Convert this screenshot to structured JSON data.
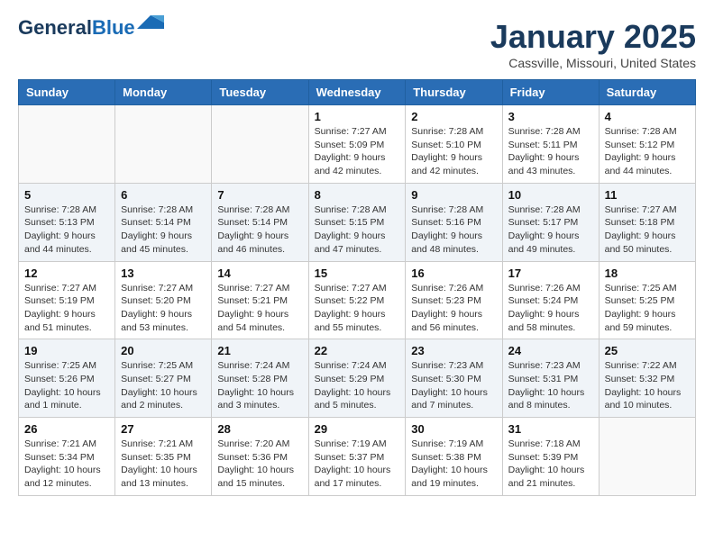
{
  "header": {
    "logo_general": "General",
    "logo_blue": "Blue",
    "month": "January 2025",
    "location": "Cassville, Missouri, United States"
  },
  "weekdays": [
    "Sunday",
    "Monday",
    "Tuesday",
    "Wednesday",
    "Thursday",
    "Friday",
    "Saturday"
  ],
  "weeks": [
    [
      {
        "day": "",
        "info": ""
      },
      {
        "day": "",
        "info": ""
      },
      {
        "day": "",
        "info": ""
      },
      {
        "day": "1",
        "info": "Sunrise: 7:27 AM\nSunset: 5:09 PM\nDaylight: 9 hours and 42 minutes."
      },
      {
        "day": "2",
        "info": "Sunrise: 7:28 AM\nSunset: 5:10 PM\nDaylight: 9 hours and 42 minutes."
      },
      {
        "day": "3",
        "info": "Sunrise: 7:28 AM\nSunset: 5:11 PM\nDaylight: 9 hours and 43 minutes."
      },
      {
        "day": "4",
        "info": "Sunrise: 7:28 AM\nSunset: 5:12 PM\nDaylight: 9 hours and 44 minutes."
      }
    ],
    [
      {
        "day": "5",
        "info": "Sunrise: 7:28 AM\nSunset: 5:13 PM\nDaylight: 9 hours and 44 minutes."
      },
      {
        "day": "6",
        "info": "Sunrise: 7:28 AM\nSunset: 5:14 PM\nDaylight: 9 hours and 45 minutes."
      },
      {
        "day": "7",
        "info": "Sunrise: 7:28 AM\nSunset: 5:14 PM\nDaylight: 9 hours and 46 minutes."
      },
      {
        "day": "8",
        "info": "Sunrise: 7:28 AM\nSunset: 5:15 PM\nDaylight: 9 hours and 47 minutes."
      },
      {
        "day": "9",
        "info": "Sunrise: 7:28 AM\nSunset: 5:16 PM\nDaylight: 9 hours and 48 minutes."
      },
      {
        "day": "10",
        "info": "Sunrise: 7:28 AM\nSunset: 5:17 PM\nDaylight: 9 hours and 49 minutes."
      },
      {
        "day": "11",
        "info": "Sunrise: 7:27 AM\nSunset: 5:18 PM\nDaylight: 9 hours and 50 minutes."
      }
    ],
    [
      {
        "day": "12",
        "info": "Sunrise: 7:27 AM\nSunset: 5:19 PM\nDaylight: 9 hours and 51 minutes."
      },
      {
        "day": "13",
        "info": "Sunrise: 7:27 AM\nSunset: 5:20 PM\nDaylight: 9 hours and 53 minutes."
      },
      {
        "day": "14",
        "info": "Sunrise: 7:27 AM\nSunset: 5:21 PM\nDaylight: 9 hours and 54 minutes."
      },
      {
        "day": "15",
        "info": "Sunrise: 7:27 AM\nSunset: 5:22 PM\nDaylight: 9 hours and 55 minutes."
      },
      {
        "day": "16",
        "info": "Sunrise: 7:26 AM\nSunset: 5:23 PM\nDaylight: 9 hours and 56 minutes."
      },
      {
        "day": "17",
        "info": "Sunrise: 7:26 AM\nSunset: 5:24 PM\nDaylight: 9 hours and 58 minutes."
      },
      {
        "day": "18",
        "info": "Sunrise: 7:25 AM\nSunset: 5:25 PM\nDaylight: 9 hours and 59 minutes."
      }
    ],
    [
      {
        "day": "19",
        "info": "Sunrise: 7:25 AM\nSunset: 5:26 PM\nDaylight: 10 hours and 1 minute."
      },
      {
        "day": "20",
        "info": "Sunrise: 7:25 AM\nSunset: 5:27 PM\nDaylight: 10 hours and 2 minutes."
      },
      {
        "day": "21",
        "info": "Sunrise: 7:24 AM\nSunset: 5:28 PM\nDaylight: 10 hours and 3 minutes."
      },
      {
        "day": "22",
        "info": "Sunrise: 7:24 AM\nSunset: 5:29 PM\nDaylight: 10 hours and 5 minutes."
      },
      {
        "day": "23",
        "info": "Sunrise: 7:23 AM\nSunset: 5:30 PM\nDaylight: 10 hours and 7 minutes."
      },
      {
        "day": "24",
        "info": "Sunrise: 7:23 AM\nSunset: 5:31 PM\nDaylight: 10 hours and 8 minutes."
      },
      {
        "day": "25",
        "info": "Sunrise: 7:22 AM\nSunset: 5:32 PM\nDaylight: 10 hours and 10 minutes."
      }
    ],
    [
      {
        "day": "26",
        "info": "Sunrise: 7:21 AM\nSunset: 5:34 PM\nDaylight: 10 hours and 12 minutes."
      },
      {
        "day": "27",
        "info": "Sunrise: 7:21 AM\nSunset: 5:35 PM\nDaylight: 10 hours and 13 minutes."
      },
      {
        "day": "28",
        "info": "Sunrise: 7:20 AM\nSunset: 5:36 PM\nDaylight: 10 hours and 15 minutes."
      },
      {
        "day": "29",
        "info": "Sunrise: 7:19 AM\nSunset: 5:37 PM\nDaylight: 10 hours and 17 minutes."
      },
      {
        "day": "30",
        "info": "Sunrise: 7:19 AM\nSunset: 5:38 PM\nDaylight: 10 hours and 19 minutes."
      },
      {
        "day": "31",
        "info": "Sunrise: 7:18 AM\nSunset: 5:39 PM\nDaylight: 10 hours and 21 minutes."
      },
      {
        "day": "",
        "info": ""
      }
    ]
  ]
}
